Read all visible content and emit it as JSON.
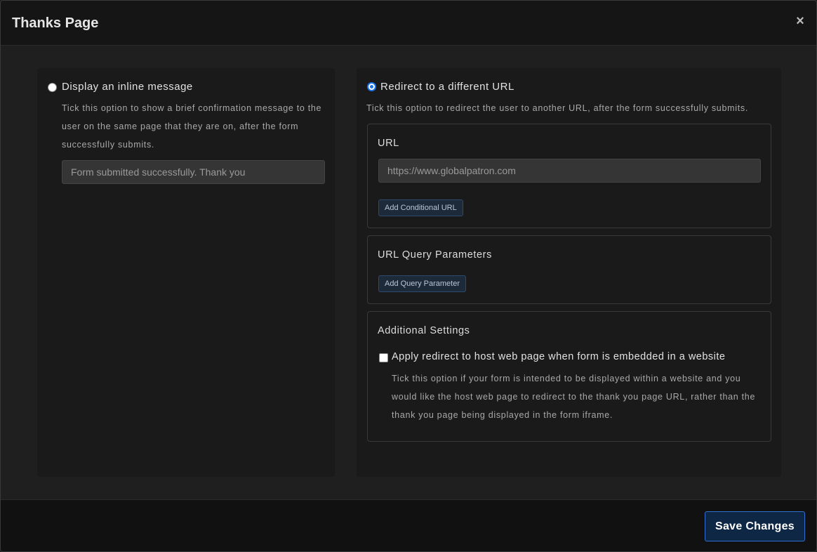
{
  "modal": {
    "title": "Thanks Page",
    "close_icon": "×"
  },
  "inline_option": {
    "label": "Display an inline message",
    "selected": false,
    "help": "Tick this option to show a brief confirmation message to the user on the same page that they are on, after the form successfully submits.",
    "message_value": "Form submitted successfully. Thank you"
  },
  "redirect_option": {
    "label": "Redirect to a different URL",
    "selected": true,
    "help": "Tick this option to redirect the user to another URL, after the form successfully submits.",
    "url_section": {
      "title": "URL",
      "url_value": "https://www.globalpatron.com",
      "add_conditional_label": "Add Conditional URL"
    },
    "query_section": {
      "title": "URL Query Parameters",
      "add_param_label": "Add Query Parameter"
    },
    "additional_section": {
      "title": "Additional Settings",
      "checkbox_label": "Apply redirect to host web page when form is embedded in a website",
      "checkbox_checked": false,
      "help": "Tick this option if your form is intended to be displayed within a website and you would like the host web page to redirect to the thank you page URL, rather than the thank you page being displayed in the form iframe."
    }
  },
  "footer": {
    "save_label": "Save Changes"
  },
  "colors": {
    "accent": "#1a73e8",
    "save_bg": "#0e2744",
    "panel_bg": "#1a1a1a"
  }
}
